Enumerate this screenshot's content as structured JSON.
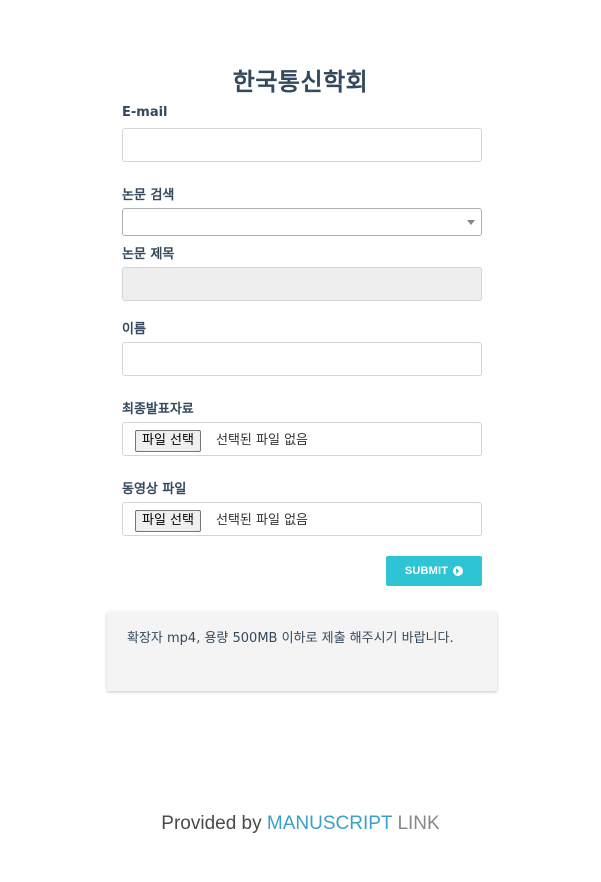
{
  "header": {
    "title": "한국통신학회"
  },
  "form": {
    "email": {
      "label": "E-mail",
      "value": ""
    },
    "paper_search": {
      "label": "논문 검색",
      "selected": ""
    },
    "paper_title": {
      "label": "논문 제목",
      "value": ""
    },
    "name": {
      "label": "이름",
      "value": ""
    },
    "final_material": {
      "label": "최종발표자료",
      "button_label": "파일 선택",
      "status": "선택된 파일 없음"
    },
    "video_file": {
      "label": "동영상 파일",
      "button_label": "파일 선택",
      "status": "선택된 파일 없음"
    },
    "submit": {
      "label": "SUBMIT",
      "icon": "arrow-circle-right-icon",
      "color": "#2ec4d6"
    }
  },
  "notice": {
    "text": "확장자 mp4, 용량 500MB 이하로 제출 해주시기 바랍니다."
  },
  "footer": {
    "prefix": "Provided by ",
    "brand_primary": "MANUSCRIPT",
    "brand_secondary": " LINK",
    "brand_color": "#3aa0c8"
  }
}
